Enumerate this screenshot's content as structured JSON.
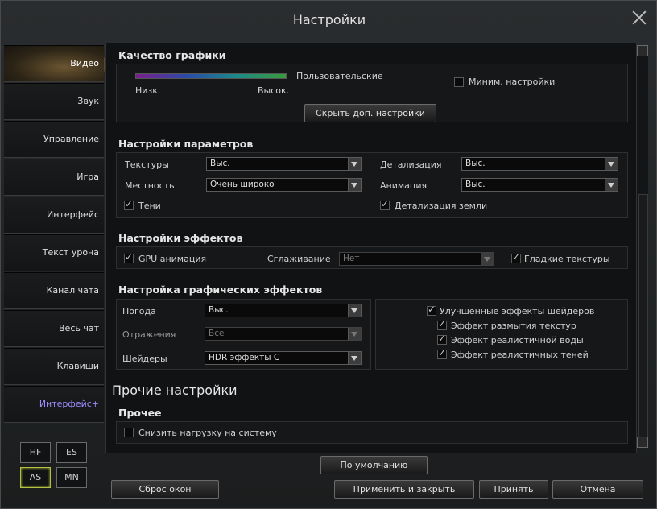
{
  "window": {
    "title": "Настройки"
  },
  "sidebar": {
    "items": [
      {
        "label": "Видео"
      },
      {
        "label": "Звук"
      },
      {
        "label": "Управление"
      },
      {
        "label": "Игра"
      },
      {
        "label": "Интерфейс"
      },
      {
        "label": "Текст урона"
      },
      {
        "label": "Канал чата"
      },
      {
        "label": "Весь чат"
      },
      {
        "label": "Клавиши"
      },
      {
        "label": "Интерфейс+"
      }
    ]
  },
  "modes": {
    "hf": "HF",
    "es": "ES",
    "as": "AS",
    "mn": "MN"
  },
  "quality": {
    "title": "Качество графики",
    "preset": "Пользовательские",
    "low": "Низк.",
    "high": "Высок.",
    "min_settings": "Миним. настройки",
    "hide_button": "Скрыть доп. настройки"
  },
  "params": {
    "title": "Настройки параметров",
    "textures_label": "Текстуры",
    "textures_value": "Выс.",
    "detail_label": "Детализация",
    "detail_value": "Выс.",
    "terrain_label": "Местность",
    "terrain_value": "Очень широко",
    "animation_label": "Анимация",
    "animation_value": "Выс.",
    "shadows": "Тени",
    "ground_detail": "Детализация земли"
  },
  "effects": {
    "title": "Настройки эффектов",
    "gpu_anim": "GPU анимация",
    "aa_label": "Сглаживание",
    "aa_value": "Нет",
    "smooth_textures": "Гладкие текстуры"
  },
  "gfx": {
    "title": "Настройка графических эффектов",
    "weather_label": "Погода",
    "weather_value": "Выс.",
    "reflect_label": "Отражения",
    "reflect_value": "Все",
    "shaders_label": "Шейдеры",
    "shaders_value": "HDR эффекты С",
    "improved_shaders": "Улучшенные эффекты шейдеров",
    "blur": "Эффект размытия текстур",
    "water": "Эффект реалистичной воды",
    "real_shadows": "Эффект реалистичных теней"
  },
  "other": {
    "heading": "Прочие настройки",
    "title": "Прочее",
    "reduce_load": "Снизить нагрузку на систему"
  },
  "footer": {
    "default": "По умолчанию",
    "reset": "Сброс окон",
    "apply_close": "Применить и закрыть",
    "accept": "Принять",
    "cancel": "Отмена"
  }
}
